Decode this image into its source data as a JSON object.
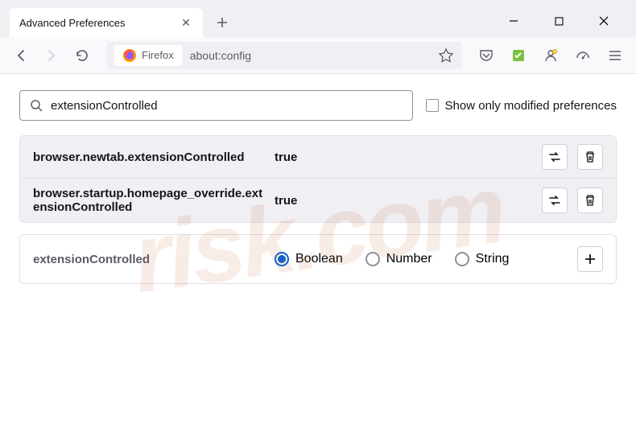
{
  "tab": {
    "title": "Advanced Preferences"
  },
  "urlbar": {
    "identity": "Firefox",
    "url": "about:config"
  },
  "search": {
    "value": "extensionControlled",
    "checkbox_label": "Show only modified preferences"
  },
  "prefs": [
    {
      "name": "browser.newtab.extensionControlled",
      "value": "true"
    },
    {
      "name": "browser.startup.homepage_override.extensionControlled",
      "value": "true"
    }
  ],
  "add": {
    "name": "extensionControlled",
    "types": [
      "Boolean",
      "Number",
      "String"
    ],
    "selected": "Boolean"
  },
  "watermark": {
    "big": "risk.com"
  }
}
